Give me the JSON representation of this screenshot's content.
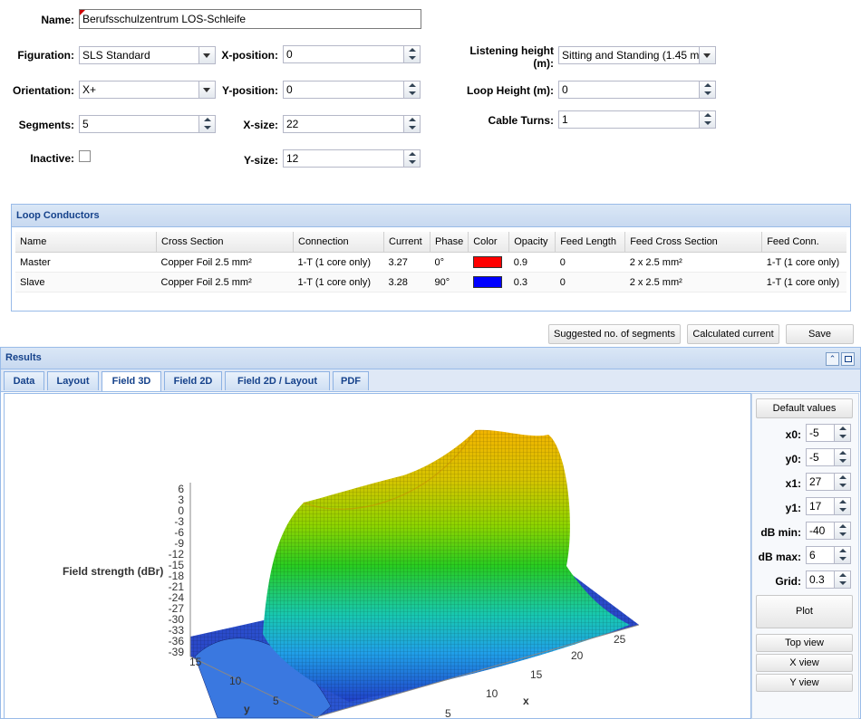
{
  "form": {
    "name_label": "Name:",
    "name_value": "Berufsschulzentrum LOS-Schleife",
    "figuration_label": "Figuration:",
    "figuration_value": "SLS Standard",
    "orientation_label": "Orientation:",
    "orientation_value": "X+",
    "segments_label": "Segments:",
    "segments_value": "5",
    "inactive_label": "Inactive:",
    "xpos_label": "X-position:",
    "xpos_value": "0",
    "ypos_label": "Y-position:",
    "ypos_value": "0",
    "xsize_label": "X-size:",
    "xsize_value": "22",
    "ysize_label": "Y-size:",
    "ysize_value": "12",
    "listening_label_1": "Listening height",
    "listening_label_2": "(m):",
    "listening_value": "Sitting and Standing (1.45 m",
    "loop_height_label": "Loop Height (m):",
    "loop_height_value": "0",
    "cable_turns_label": "Cable Turns:",
    "cable_turns_value": "1"
  },
  "conductors": {
    "title": "Loop Conductors",
    "columns": [
      "Name",
      "Cross Section",
      "Connection",
      "Current",
      "Phase",
      "Color",
      "Opacity",
      "Feed Length",
      "Feed Cross Section",
      "Feed Conn."
    ],
    "rows": [
      {
        "name": "Master",
        "cross": "Copper Foil 2.5 mm²",
        "conn": "1-T (1 core only)",
        "current": "3.27",
        "phase": "0°",
        "color": "#ff0000",
        "opacity": "0.9",
        "feed_len": "0",
        "feed_cross": "2 x 2.5 mm²",
        "feed_conn": "1-T (1 core only)"
      },
      {
        "name": "Slave",
        "cross": "Copper Foil 2.5 mm²",
        "conn": "1-T (1 core only)",
        "current": "3.28",
        "phase": "90°",
        "color": "#0000ff",
        "opacity": "0.3",
        "feed_len": "0",
        "feed_cross": "2 x 2.5 mm²",
        "feed_conn": "1-T (1 core only)"
      }
    ]
  },
  "actions": {
    "suggested": "Suggested no. of segments",
    "calculated": "Calculated current",
    "save": "Save"
  },
  "results": {
    "title": "Results",
    "tabs": [
      "Data",
      "Layout",
      "Field 3D",
      "Field 2D",
      "Field 2D / Layout",
      "PDF"
    ],
    "active_tab": "Field 3D"
  },
  "plot": {
    "z_label": "Field strength (dBr)",
    "z_ticks": [
      "6",
      "3",
      "0",
      "-3",
      "-6",
      "-9",
      "-12",
      "-15",
      "-18",
      "-21",
      "-24",
      "-27",
      "-30",
      "-33",
      "-36",
      "-39"
    ],
    "x_label": "x",
    "x_ticks": [
      "5",
      "10",
      "15",
      "20",
      "25"
    ],
    "y_label": "y",
    "y_ticks": [
      "15",
      "10",
      "5"
    ]
  },
  "side": {
    "default_values": "Default values",
    "fields": [
      {
        "label": "x0:",
        "value": "-5"
      },
      {
        "label": "y0:",
        "value": "-5"
      },
      {
        "label": "x1:",
        "value": "27"
      },
      {
        "label": "y1:",
        "value": "17"
      },
      {
        "label": "dB min:",
        "value": "-40"
      },
      {
        "label": "dB max:",
        "value": "6"
      },
      {
        "label": "Grid:",
        "value": "0.3"
      }
    ],
    "plot": "Plot",
    "top_view": "Top view",
    "x_view": "X view",
    "y_view": "Y view"
  },
  "colors": {
    "panel_header": "#c8d9f0",
    "accent": "#15428b",
    "master": "#ff0000",
    "slave": "#0000ff"
  }
}
